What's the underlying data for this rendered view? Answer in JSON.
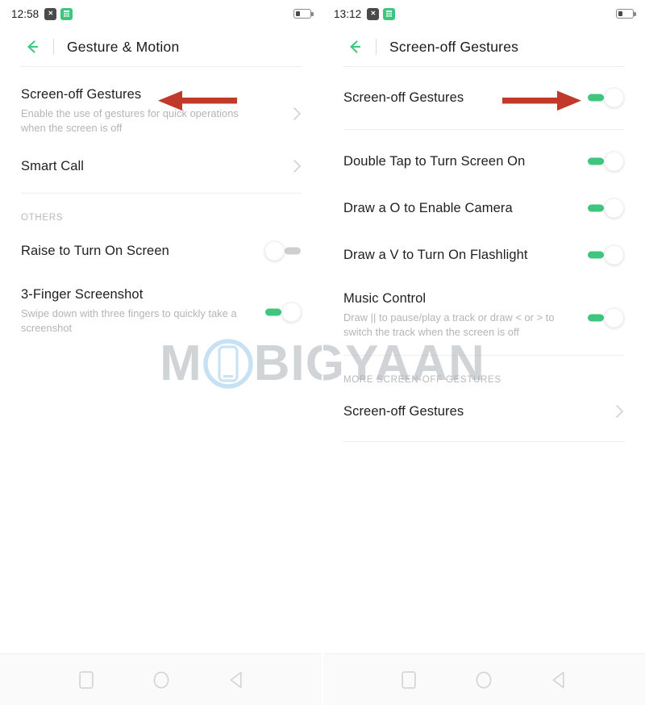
{
  "colors": {
    "accent_green": "#3ec67e",
    "annotation_red": "#c0392b",
    "toggle_off_gray": "#cfcfcf",
    "text_primary": "#1f1f1f",
    "text_secondary": "#b4b4b4",
    "navbar_bg": "#fafafa"
  },
  "left_panel": {
    "statusbar": {
      "clock": "12:58",
      "icons": [
        "close-badge-icon",
        "calculator-icon"
      ],
      "battery_icon": "battery-low-icon"
    },
    "titlebar": {
      "back_icon": "back-arrow-icon",
      "title": "Gesture & Motion"
    },
    "items": [
      {
        "title": "Screen-off Gestures",
        "subtitle": "Enable the use of gestures for quick operations when the screen is off",
        "control": "chevron"
      },
      {
        "title": "Smart Call",
        "subtitle": "",
        "control": "chevron"
      }
    ],
    "section_label": "OTHERS",
    "others": [
      {
        "title": "Raise to Turn On Screen",
        "subtitle": "",
        "control": "toggle",
        "toggle_state": "off"
      },
      {
        "title": "3-Finger Screenshot",
        "subtitle": "Swipe down with three fingers to quickly take a screenshot",
        "control": "toggle",
        "toggle_state": "on"
      }
    ],
    "annotation": {
      "type": "arrow-left-icon",
      "color": "#c0392b"
    }
  },
  "right_panel": {
    "statusbar": {
      "clock": "13:12",
      "icons": [
        "close-badge-icon",
        "calculator-icon"
      ],
      "battery_icon": "battery-low-icon"
    },
    "titlebar": {
      "back_icon": "back-arrow-icon",
      "title": "Screen-off Gestures"
    },
    "master": {
      "title": "Screen-off Gestures",
      "control": "toggle",
      "toggle_state": "on"
    },
    "gestures": [
      {
        "title": "Double Tap to Turn Screen On",
        "subtitle": "",
        "control": "toggle",
        "toggle_state": "on"
      },
      {
        "title": "Draw a  O  to Enable Camera",
        "subtitle": "",
        "control": "toggle",
        "toggle_state": "on"
      },
      {
        "title": "Draw a  V  to Turn On Flashlight",
        "subtitle": "",
        "control": "toggle",
        "toggle_state": "on"
      },
      {
        "title": "Music Control",
        "subtitle": "Draw || to pause/play a track or draw < or > to switch the track when the screen is off",
        "control": "toggle",
        "toggle_state": "on"
      }
    ],
    "section_label": "MORE SCREEN-OFF GESTURES",
    "more": [
      {
        "title": "Screen-off Gestures",
        "subtitle": "",
        "control": "chevron"
      }
    ],
    "annotation": {
      "type": "arrow-right-icon",
      "color": "#c0392b"
    }
  },
  "watermark": {
    "text_before": "M",
    "text_after": "BIGYAAN",
    "logo": "phone-outline-icon"
  },
  "navbar": {
    "buttons": [
      "recents-square-icon",
      "home-circle-icon",
      "back-triangle-icon"
    ]
  }
}
